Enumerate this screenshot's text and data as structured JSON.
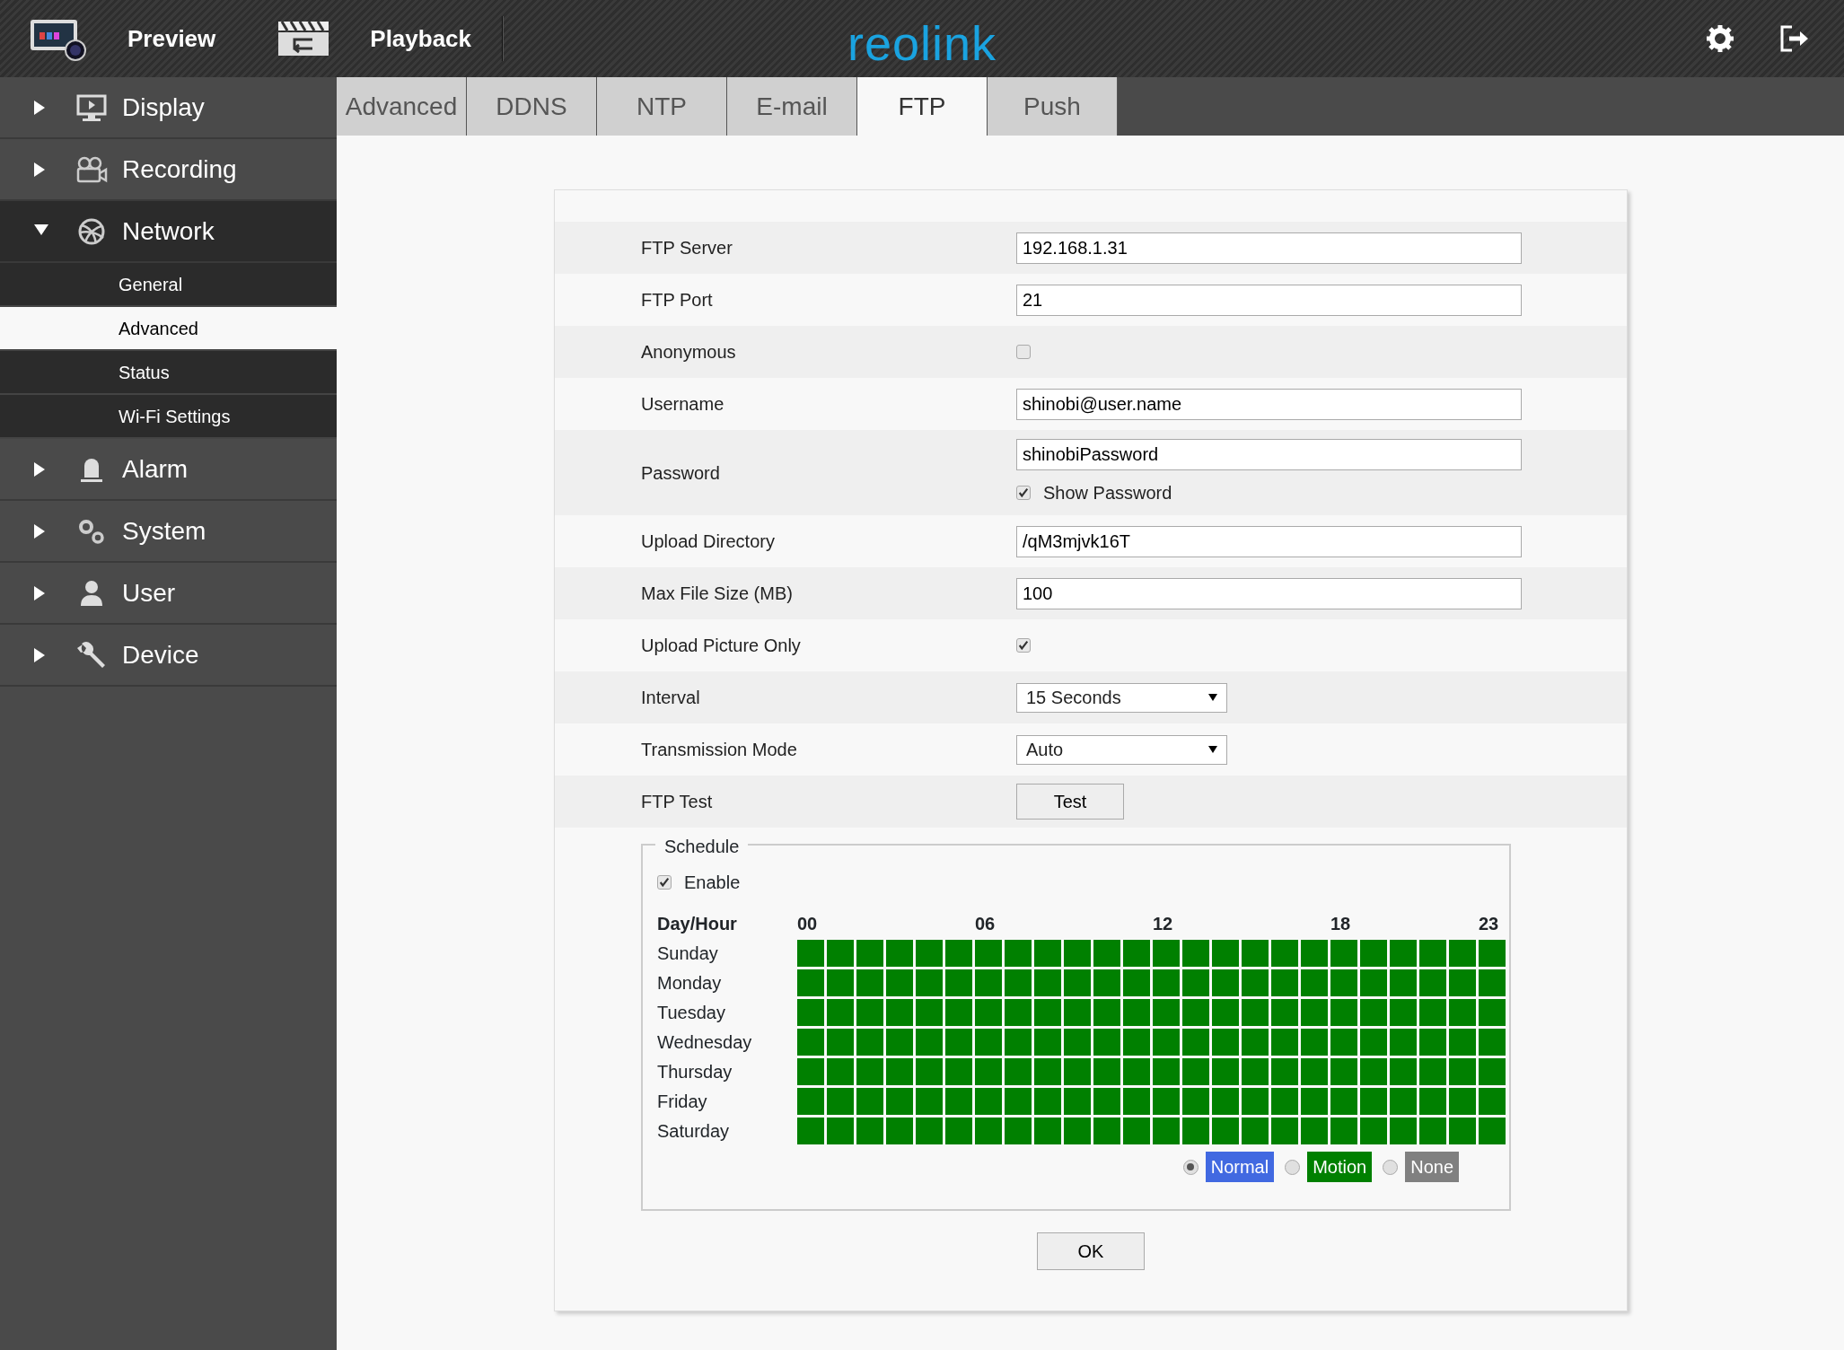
{
  "header": {
    "nav": [
      {
        "label": "Preview",
        "kind": "preview"
      },
      {
        "label": "Playback",
        "kind": "playback"
      }
    ],
    "logo": "reolink"
  },
  "sidebar": {
    "items": [
      {
        "label": "Display",
        "kind": "display",
        "expanded": false
      },
      {
        "label": "Recording",
        "kind": "recording",
        "expanded": false
      },
      {
        "label": "Network",
        "kind": "network",
        "expanded": true,
        "children": [
          {
            "label": "General",
            "selected": false
          },
          {
            "label": "Advanced",
            "selected": true
          },
          {
            "label": "Status",
            "selected": false
          },
          {
            "label": "Wi-Fi Settings",
            "selected": false
          }
        ]
      },
      {
        "label": "Alarm",
        "kind": "alarm",
        "expanded": false
      },
      {
        "label": "System",
        "kind": "system",
        "expanded": false
      },
      {
        "label": "User",
        "kind": "user",
        "expanded": false
      },
      {
        "label": "Device",
        "kind": "device",
        "expanded": false
      }
    ]
  },
  "tabs": [
    {
      "label": "Advanced",
      "selected": false
    },
    {
      "label": "DDNS",
      "selected": false
    },
    {
      "label": "NTP",
      "selected": false
    },
    {
      "label": "E-mail",
      "selected": false
    },
    {
      "label": "FTP",
      "selected": true
    },
    {
      "label": "Push",
      "selected": false
    }
  ],
  "form": {
    "rows": [
      {
        "kind": "text",
        "label": "FTP Server",
        "value": "192.168.1.31"
      },
      {
        "kind": "text",
        "label": "FTP Port",
        "value": "21"
      },
      {
        "kind": "checkbox",
        "label": "Anonymous",
        "checked": false
      },
      {
        "kind": "text",
        "label": "Username",
        "value": "shinobi@user.name"
      },
      {
        "kind": "password",
        "label": "Password",
        "value": "shinobiPassword",
        "show_label": "Show Password",
        "checked": true
      },
      {
        "kind": "text",
        "label": "Upload Directory",
        "value": "/qM3mjvk16T"
      },
      {
        "kind": "text",
        "label": "Max File Size (MB)",
        "value": "100"
      },
      {
        "kind": "checkbox",
        "label": "Upload Picture Only",
        "checked": true
      },
      {
        "kind": "select",
        "label": "Interval",
        "value": "15 Seconds"
      },
      {
        "kind": "select",
        "label": "Transmission Mode",
        "value": "Auto"
      },
      {
        "kind": "button",
        "label": "FTP Test",
        "value": "Test"
      }
    ]
  },
  "schedule": {
    "title": "Schedule",
    "enable_label": "Enable",
    "enabled": true,
    "corner": "Day/Hour",
    "hour_labels": [
      "00",
      "06",
      "12",
      "18",
      "23"
    ],
    "days": [
      {
        "label": "Sunday",
        "hours": [
          {
            "kind": "motion"
          },
          {
            "kind": "motion"
          },
          {
            "kind": "motion"
          },
          {
            "kind": "motion"
          },
          {
            "kind": "motion"
          },
          {
            "kind": "motion"
          },
          {
            "kind": "motion"
          },
          {
            "kind": "motion"
          },
          {
            "kind": "motion"
          },
          {
            "kind": "motion"
          },
          {
            "kind": "motion"
          },
          {
            "kind": "motion"
          },
          {
            "kind": "motion"
          },
          {
            "kind": "motion"
          },
          {
            "kind": "motion"
          },
          {
            "kind": "motion"
          },
          {
            "kind": "motion"
          },
          {
            "kind": "motion"
          },
          {
            "kind": "motion"
          },
          {
            "kind": "motion"
          },
          {
            "kind": "motion"
          },
          {
            "kind": "motion"
          },
          {
            "kind": "motion"
          },
          {
            "kind": "motion"
          }
        ]
      },
      {
        "label": "Monday",
        "hours": [
          {
            "kind": "motion"
          },
          {
            "kind": "motion"
          },
          {
            "kind": "motion"
          },
          {
            "kind": "motion"
          },
          {
            "kind": "motion"
          },
          {
            "kind": "motion"
          },
          {
            "kind": "motion"
          },
          {
            "kind": "motion"
          },
          {
            "kind": "motion"
          },
          {
            "kind": "motion"
          },
          {
            "kind": "motion"
          },
          {
            "kind": "motion"
          },
          {
            "kind": "motion"
          },
          {
            "kind": "motion"
          },
          {
            "kind": "motion"
          },
          {
            "kind": "motion"
          },
          {
            "kind": "motion"
          },
          {
            "kind": "motion"
          },
          {
            "kind": "motion"
          },
          {
            "kind": "motion"
          },
          {
            "kind": "motion"
          },
          {
            "kind": "motion"
          },
          {
            "kind": "motion"
          },
          {
            "kind": "motion"
          }
        ]
      },
      {
        "label": "Tuesday",
        "hours": [
          {
            "kind": "motion"
          },
          {
            "kind": "motion"
          },
          {
            "kind": "motion"
          },
          {
            "kind": "motion"
          },
          {
            "kind": "motion"
          },
          {
            "kind": "motion"
          },
          {
            "kind": "motion"
          },
          {
            "kind": "motion"
          },
          {
            "kind": "motion"
          },
          {
            "kind": "motion"
          },
          {
            "kind": "motion"
          },
          {
            "kind": "motion"
          },
          {
            "kind": "motion"
          },
          {
            "kind": "motion"
          },
          {
            "kind": "motion"
          },
          {
            "kind": "motion"
          },
          {
            "kind": "motion"
          },
          {
            "kind": "motion"
          },
          {
            "kind": "motion"
          },
          {
            "kind": "motion"
          },
          {
            "kind": "motion"
          },
          {
            "kind": "motion"
          },
          {
            "kind": "motion"
          },
          {
            "kind": "motion"
          }
        ]
      },
      {
        "label": "Wednesday",
        "hours": [
          {
            "kind": "motion"
          },
          {
            "kind": "motion"
          },
          {
            "kind": "motion"
          },
          {
            "kind": "motion"
          },
          {
            "kind": "motion"
          },
          {
            "kind": "motion"
          },
          {
            "kind": "motion"
          },
          {
            "kind": "motion"
          },
          {
            "kind": "motion"
          },
          {
            "kind": "motion"
          },
          {
            "kind": "motion"
          },
          {
            "kind": "motion"
          },
          {
            "kind": "motion"
          },
          {
            "kind": "motion"
          },
          {
            "kind": "motion"
          },
          {
            "kind": "motion"
          },
          {
            "kind": "motion"
          },
          {
            "kind": "motion"
          },
          {
            "kind": "motion"
          },
          {
            "kind": "motion"
          },
          {
            "kind": "motion"
          },
          {
            "kind": "motion"
          },
          {
            "kind": "motion"
          },
          {
            "kind": "motion"
          }
        ]
      },
      {
        "label": "Thursday",
        "hours": [
          {
            "kind": "motion"
          },
          {
            "kind": "motion"
          },
          {
            "kind": "motion"
          },
          {
            "kind": "motion"
          },
          {
            "kind": "motion"
          },
          {
            "kind": "motion"
          },
          {
            "kind": "motion"
          },
          {
            "kind": "motion"
          },
          {
            "kind": "motion"
          },
          {
            "kind": "motion"
          },
          {
            "kind": "motion"
          },
          {
            "kind": "motion"
          },
          {
            "kind": "motion"
          },
          {
            "kind": "motion"
          },
          {
            "kind": "motion"
          },
          {
            "kind": "motion"
          },
          {
            "kind": "motion"
          },
          {
            "kind": "motion"
          },
          {
            "kind": "motion"
          },
          {
            "kind": "motion"
          },
          {
            "kind": "motion"
          },
          {
            "kind": "motion"
          },
          {
            "kind": "motion"
          },
          {
            "kind": "motion"
          }
        ]
      },
      {
        "label": "Friday",
        "hours": [
          {
            "kind": "motion"
          },
          {
            "kind": "motion"
          },
          {
            "kind": "motion"
          },
          {
            "kind": "motion"
          },
          {
            "kind": "motion"
          },
          {
            "kind": "motion"
          },
          {
            "kind": "motion"
          },
          {
            "kind": "motion"
          },
          {
            "kind": "motion"
          },
          {
            "kind": "motion"
          },
          {
            "kind": "motion"
          },
          {
            "kind": "motion"
          },
          {
            "kind": "motion"
          },
          {
            "kind": "motion"
          },
          {
            "kind": "motion"
          },
          {
            "kind": "motion"
          },
          {
            "kind": "motion"
          },
          {
            "kind": "motion"
          },
          {
            "kind": "motion"
          },
          {
            "kind": "motion"
          },
          {
            "kind": "motion"
          },
          {
            "kind": "motion"
          },
          {
            "kind": "motion"
          },
          {
            "kind": "motion"
          }
        ]
      },
      {
        "label": "Saturday",
        "hours": [
          {
            "kind": "motion"
          },
          {
            "kind": "motion"
          },
          {
            "kind": "motion"
          },
          {
            "kind": "motion"
          },
          {
            "kind": "motion"
          },
          {
            "kind": "motion"
          },
          {
            "kind": "motion"
          },
          {
            "kind": "motion"
          },
          {
            "kind": "motion"
          },
          {
            "kind": "motion"
          },
          {
            "kind": "motion"
          },
          {
            "kind": "motion"
          },
          {
            "kind": "motion"
          },
          {
            "kind": "motion"
          },
          {
            "kind": "motion"
          },
          {
            "kind": "motion"
          },
          {
            "kind": "motion"
          },
          {
            "kind": "motion"
          },
          {
            "kind": "motion"
          },
          {
            "kind": "motion"
          },
          {
            "kind": "motion"
          },
          {
            "kind": "motion"
          },
          {
            "kind": "motion"
          },
          {
            "kind": "motion"
          }
        ]
      }
    ],
    "legend": [
      {
        "kind": "normal",
        "label": "Normal",
        "color": "#4169e1",
        "selected": true
      },
      {
        "kind": "motion",
        "label": "Motion",
        "color": "#008000",
        "selected": false
      },
      {
        "kind": "none",
        "label": "None",
        "color": "#808080",
        "selected": false
      }
    ]
  },
  "ok_button": "OK"
}
